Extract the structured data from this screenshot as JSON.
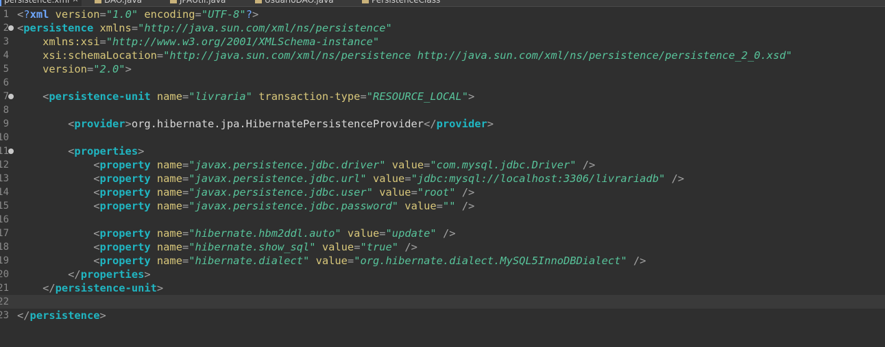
{
  "tabs": [
    {
      "label": "persistence.xml",
      "active": true
    },
    {
      "label": "DAO.java",
      "active": false
    },
    {
      "label": "JPAUtil.java",
      "active": false
    },
    {
      "label": "UsuarioDAO.java",
      "active": false
    },
    {
      "label": "PersistenceClass",
      "active": false
    }
  ],
  "lines": [
    {
      "num": "1",
      "fold": false,
      "current": false,
      "tokens": [
        {
          "c": "br",
          "t": "<"
        },
        {
          "c": "k",
          "t": "?"
        },
        {
          "c": "b",
          "t": "xml"
        },
        {
          "c": "an",
          "t": " version"
        },
        {
          "c": "br",
          "t": "="
        },
        {
          "c": "av",
          "t": "\"1.0\""
        },
        {
          "c": "an",
          "t": " encoding"
        },
        {
          "c": "br",
          "t": "="
        },
        {
          "c": "av",
          "t": "\"UTF-8\""
        },
        {
          "c": "k",
          "t": "?"
        },
        {
          "c": "br",
          "t": ">"
        }
      ]
    },
    {
      "num": "2",
      "fold": true,
      "current": false,
      "tokens": [
        {
          "c": "br",
          "t": "<"
        },
        {
          "c": "tg",
          "t": "persistence"
        },
        {
          "c": "an",
          "t": " xmlns"
        },
        {
          "c": "br",
          "t": "="
        },
        {
          "c": "av",
          "t": "\"http://java.sun.com/xml/ns/persistence\""
        }
      ]
    },
    {
      "num": "3",
      "fold": false,
      "current": false,
      "tokens": [
        {
          "c": "tx",
          "t": "    "
        },
        {
          "c": "an",
          "t": "xmlns:xsi"
        },
        {
          "c": "br",
          "t": "="
        },
        {
          "c": "av",
          "t": "\"http://www.w3.org/2001/XMLSchema-instance\""
        }
      ]
    },
    {
      "num": "4",
      "fold": false,
      "current": false,
      "tokens": [
        {
          "c": "tx",
          "t": "    "
        },
        {
          "c": "an",
          "t": "xsi:schemaLocation"
        },
        {
          "c": "br",
          "t": "="
        },
        {
          "c": "av",
          "t": "\"http://java.sun.com/xml/ns/persistence http://java.sun.com/xml/ns/persistence/persistence_2_0.xsd\""
        }
      ]
    },
    {
      "num": "5",
      "fold": false,
      "current": false,
      "tokens": [
        {
          "c": "tx",
          "t": "    "
        },
        {
          "c": "an",
          "t": "version"
        },
        {
          "c": "br",
          "t": "="
        },
        {
          "c": "av",
          "t": "\"2.0\""
        },
        {
          "c": "br",
          "t": ">"
        }
      ]
    },
    {
      "num": "6",
      "fold": false,
      "current": false,
      "tokens": []
    },
    {
      "num": "7",
      "fold": true,
      "current": false,
      "tokens": [
        {
          "c": "tx",
          "t": "    "
        },
        {
          "c": "br",
          "t": "<"
        },
        {
          "c": "tg",
          "t": "persistence-unit"
        },
        {
          "c": "an",
          "t": " name"
        },
        {
          "c": "br",
          "t": "="
        },
        {
          "c": "av",
          "t": "\"livraria\""
        },
        {
          "c": "an",
          "t": " transaction-type"
        },
        {
          "c": "br",
          "t": "="
        },
        {
          "c": "av",
          "t": "\"RESOURCE_LOCAL\""
        },
        {
          "c": "br",
          "t": ">"
        }
      ]
    },
    {
      "num": "8",
      "fold": false,
      "current": false,
      "tokens": []
    },
    {
      "num": "9",
      "fold": false,
      "current": false,
      "tokens": [
        {
          "c": "tx",
          "t": "        "
        },
        {
          "c": "br",
          "t": "<"
        },
        {
          "c": "tg",
          "t": "provider"
        },
        {
          "c": "br",
          "t": ">"
        },
        {
          "c": "tx",
          "t": "org.hibernate.jpa.HibernatePersistenceProvider"
        },
        {
          "c": "br",
          "t": "</"
        },
        {
          "c": "tg",
          "t": "provider"
        },
        {
          "c": "br",
          "t": ">"
        }
      ]
    },
    {
      "num": "10",
      "fold": false,
      "current": false,
      "tokens": []
    },
    {
      "num": "11",
      "fold": true,
      "current": false,
      "tokens": [
        {
          "c": "tx",
          "t": "        "
        },
        {
          "c": "br",
          "t": "<"
        },
        {
          "c": "tg",
          "t": "properties"
        },
        {
          "c": "br",
          "t": ">"
        }
      ]
    },
    {
      "num": "12",
      "fold": false,
      "current": false,
      "tokens": [
        {
          "c": "tx",
          "t": "            "
        },
        {
          "c": "br",
          "t": "<"
        },
        {
          "c": "tg",
          "t": "property"
        },
        {
          "c": "an",
          "t": " name"
        },
        {
          "c": "br",
          "t": "="
        },
        {
          "c": "av",
          "t": "\"javax.persistence.jdbc.driver\""
        },
        {
          "c": "an",
          "t": " value"
        },
        {
          "c": "br",
          "t": "="
        },
        {
          "c": "av",
          "t": "\"com.mysql.jdbc.Driver\""
        },
        {
          "c": "br",
          "t": " />"
        }
      ]
    },
    {
      "num": "13",
      "fold": false,
      "current": false,
      "tokens": [
        {
          "c": "tx",
          "t": "            "
        },
        {
          "c": "br",
          "t": "<"
        },
        {
          "c": "tg",
          "t": "property"
        },
        {
          "c": "an",
          "t": " name"
        },
        {
          "c": "br",
          "t": "="
        },
        {
          "c": "av",
          "t": "\"javax.persistence.jdbc.url\""
        },
        {
          "c": "an",
          "t": " value"
        },
        {
          "c": "br",
          "t": "="
        },
        {
          "c": "av",
          "t": "\"jdbc:mysql://localhost:3306/livrariadb\""
        },
        {
          "c": "br",
          "t": " />"
        }
      ]
    },
    {
      "num": "14",
      "fold": false,
      "current": false,
      "tokens": [
        {
          "c": "tx",
          "t": "            "
        },
        {
          "c": "br",
          "t": "<"
        },
        {
          "c": "tg",
          "t": "property"
        },
        {
          "c": "an",
          "t": " name"
        },
        {
          "c": "br",
          "t": "="
        },
        {
          "c": "av",
          "t": "\"javax.persistence.jdbc.user\""
        },
        {
          "c": "an",
          "t": " value"
        },
        {
          "c": "br",
          "t": "="
        },
        {
          "c": "av",
          "t": "\"root\""
        },
        {
          "c": "br",
          "t": " />"
        }
      ]
    },
    {
      "num": "15",
      "fold": false,
      "current": false,
      "tokens": [
        {
          "c": "tx",
          "t": "            "
        },
        {
          "c": "br",
          "t": "<"
        },
        {
          "c": "tg",
          "t": "property"
        },
        {
          "c": "an",
          "t": " name"
        },
        {
          "c": "br",
          "t": "="
        },
        {
          "c": "av",
          "t": "\"javax.persistence.jdbc.password\""
        },
        {
          "c": "an",
          "t": " value"
        },
        {
          "c": "br",
          "t": "="
        },
        {
          "c": "av",
          "t": "\"\""
        },
        {
          "c": "br",
          "t": " />"
        }
      ]
    },
    {
      "num": "16",
      "fold": false,
      "current": false,
      "tokens": []
    },
    {
      "num": "17",
      "fold": false,
      "current": false,
      "tokens": [
        {
          "c": "tx",
          "t": "            "
        },
        {
          "c": "br",
          "t": "<"
        },
        {
          "c": "tg",
          "t": "property"
        },
        {
          "c": "an",
          "t": " name"
        },
        {
          "c": "br",
          "t": "="
        },
        {
          "c": "av",
          "t": "\"hibernate.hbm2ddl.auto\""
        },
        {
          "c": "an",
          "t": " value"
        },
        {
          "c": "br",
          "t": "="
        },
        {
          "c": "av",
          "t": "\"update\""
        },
        {
          "c": "br",
          "t": " />"
        }
      ]
    },
    {
      "num": "18",
      "fold": false,
      "current": false,
      "tokens": [
        {
          "c": "tx",
          "t": "            "
        },
        {
          "c": "br",
          "t": "<"
        },
        {
          "c": "tg",
          "t": "property"
        },
        {
          "c": "an",
          "t": " name"
        },
        {
          "c": "br",
          "t": "="
        },
        {
          "c": "av",
          "t": "\"hibernate.show_sql\""
        },
        {
          "c": "an",
          "t": " value"
        },
        {
          "c": "br",
          "t": "="
        },
        {
          "c": "av",
          "t": "\"true\""
        },
        {
          "c": "br",
          "t": " />"
        }
      ]
    },
    {
      "num": "19",
      "fold": false,
      "current": false,
      "tokens": [
        {
          "c": "tx",
          "t": "            "
        },
        {
          "c": "br",
          "t": "<"
        },
        {
          "c": "tg",
          "t": "property"
        },
        {
          "c": "an",
          "t": " name"
        },
        {
          "c": "br",
          "t": "="
        },
        {
          "c": "av",
          "t": "\"hibernate.dialect\""
        },
        {
          "c": "an",
          "t": " value"
        },
        {
          "c": "br",
          "t": "="
        },
        {
          "c": "av",
          "t": "\"org.hibernate.dialect.MySQL5InnoDBDialect\""
        },
        {
          "c": "br",
          "t": " />"
        }
      ]
    },
    {
      "num": "20",
      "fold": false,
      "current": false,
      "tokens": [
        {
          "c": "tx",
          "t": "        "
        },
        {
          "c": "br",
          "t": "</"
        },
        {
          "c": "tg",
          "t": "properties"
        },
        {
          "c": "br",
          "t": ">"
        }
      ]
    },
    {
      "num": "21",
      "fold": false,
      "current": false,
      "tokens": [
        {
          "c": "tx",
          "t": "    "
        },
        {
          "c": "br",
          "t": "</"
        },
        {
          "c": "tg",
          "t": "persistence-unit"
        },
        {
          "c": "br",
          "t": ">"
        }
      ]
    },
    {
      "num": "22",
      "fold": false,
      "current": true,
      "tokens": []
    },
    {
      "num": "23",
      "fold": false,
      "current": false,
      "tokens": [
        {
          "c": "br",
          "t": "</"
        },
        {
          "c": "tg",
          "t": "persistence"
        },
        {
          "c": "br",
          "t": ">"
        }
      ]
    }
  ]
}
